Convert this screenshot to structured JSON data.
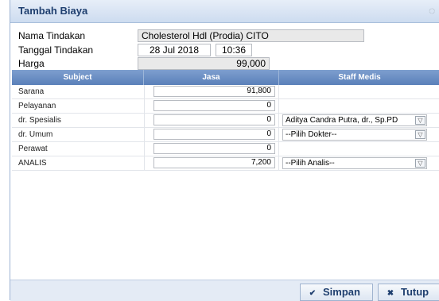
{
  "dialog": {
    "title": "Tambah Biaya"
  },
  "form": {
    "nama_tindakan_label": "Nama Tindakan",
    "nama_tindakan_value": "Cholesterol Hdl (Prodia) CITO",
    "tanggal_label": "Tanggal Tindakan",
    "tanggal_date": "28 Jul 2018",
    "tanggal_time": "10:36",
    "harga_label": "Harga",
    "harga_value": "99,000"
  },
  "grid": {
    "headers": [
      "Subject",
      "Jasa",
      "Staff Medis"
    ],
    "rows": [
      {
        "subject": "Sarana",
        "jasa": "91,800",
        "staff": ""
      },
      {
        "subject": "Pelayanan",
        "jasa": "0",
        "staff": ""
      },
      {
        "subject": "dr. Spesialis",
        "jasa": "0",
        "staff": "Aditya Candra Putra, dr., Sp.PD"
      },
      {
        "subject": "dr. Umum",
        "jasa": "0",
        "staff": "--Pilih Dokter--"
      },
      {
        "subject": "Perawat",
        "jasa": "0",
        "staff": ""
      },
      {
        "subject": "ANALIS",
        "jasa": "7,200",
        "staff": "--Pilih Analis--"
      }
    ]
  },
  "buttons": {
    "simpan": "Simpan",
    "tutup": "Tutup"
  },
  "icons": {
    "close": "close-icon",
    "check": "check-icon",
    "x": "x-icon",
    "dropdown": "chevron-down-icon"
  },
  "colors": {
    "header": "#5a80b9",
    "title": "#1f3f6f"
  }
}
